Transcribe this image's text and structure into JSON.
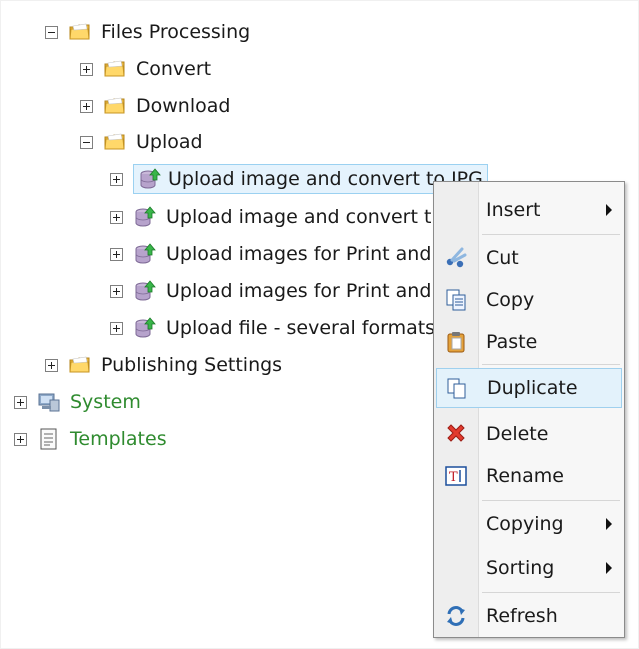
{
  "tree": {
    "nodes": [
      {
        "label": "Files Processing",
        "icon": "folder-icon",
        "toggle": "minus"
      },
      {
        "label": "Convert",
        "icon": "folder-icon",
        "toggle": "plus"
      },
      {
        "label": "Download",
        "icon": "folder-icon",
        "toggle": "plus"
      },
      {
        "label": "Upload",
        "icon": "folder-icon",
        "toggle": "minus"
      },
      {
        "label": "Upload image and convert to JPG",
        "icon": "upload-task-icon",
        "toggle": "plus"
      },
      {
        "label": "Upload image and convert t",
        "icon": "upload-task-icon",
        "toggle": "plus"
      },
      {
        "label": "Upload images for Print and",
        "icon": "upload-task-icon",
        "toggle": "plus"
      },
      {
        "label": "Upload images for Print and",
        "icon": "upload-task-icon",
        "toggle": "plus"
      },
      {
        "label": "Upload file - several formats",
        "icon": "upload-task-icon",
        "toggle": "plus"
      },
      {
        "label": "Publishing Settings",
        "icon": "folder-icon",
        "toggle": "plus"
      },
      {
        "label": "System",
        "icon": "system-icon",
        "toggle": "plus"
      },
      {
        "label": "Templates",
        "icon": "templates-icon",
        "toggle": "plus"
      }
    ]
  },
  "context_menu": {
    "items": [
      {
        "label": "Insert",
        "icon": "",
        "submenu": true
      },
      {
        "label": "Cut",
        "icon": "scissors-icon"
      },
      {
        "label": "Copy",
        "icon": "copy-icon"
      },
      {
        "label": "Paste",
        "icon": "paste-icon"
      },
      {
        "label": "Duplicate",
        "icon": "duplicate-icon",
        "highlighted": true
      },
      {
        "label": "Delete",
        "icon": "delete-icon"
      },
      {
        "label": "Rename",
        "icon": "rename-icon"
      },
      {
        "label": "Copying",
        "icon": "",
        "submenu": true
      },
      {
        "label": "Sorting",
        "icon": "",
        "submenu": true
      },
      {
        "label": "Refresh",
        "icon": "refresh-icon"
      }
    ]
  },
  "colors": {
    "selection_border": "#9bd1f1",
    "selection_fill": "#e5f3fd",
    "green_text": "#2f8b2f",
    "menu_background": "#f7f7f7"
  }
}
